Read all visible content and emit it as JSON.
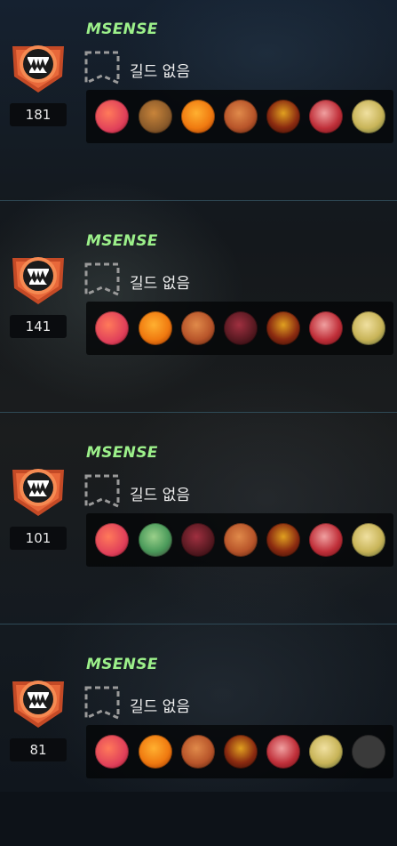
{
  "matches": [
    {
      "name": "MSENSE",
      "level": "181",
      "guild": "길드 없음",
      "champions": [
        {
          "icon": "champion-portrait-pink-fire",
          "color": "#e0405a"
        },
        {
          "icon": "champion-portrait-brown-beast",
          "color": "#8a5a2a"
        },
        {
          "icon": "champion-portrait-orange-flame",
          "color": "#f07a10"
        },
        {
          "icon": "champion-portrait-red-horned",
          "color": "#b8552a"
        },
        {
          "icon": "champion-portrait-dark-red-armor",
          "color": "#8a2a10"
        },
        {
          "icon": "champion-portrait-red-jester",
          "color": "#c0303a"
        },
        {
          "icon": "champion-portrait-yellow-knight",
          "color": "#c8b458"
        }
      ]
    },
    {
      "name": "MSENSE",
      "level": "141",
      "guild": "길드 없음",
      "champions": [
        {
          "icon": "champion-portrait-pink-fire",
          "color": "#e0405a"
        },
        {
          "icon": "champion-portrait-orange-flame",
          "color": "#f07a10"
        },
        {
          "icon": "champion-portrait-red-horned",
          "color": "#b8552a"
        },
        {
          "icon": "champion-portrait-crimson-demon",
          "color": "#5a1a22"
        },
        {
          "icon": "champion-portrait-dark-red-armor",
          "color": "#8a2a10"
        },
        {
          "icon": "champion-portrait-red-jester",
          "color": "#c0303a"
        },
        {
          "icon": "champion-portrait-yellow-knight",
          "color": "#c8b458"
        }
      ]
    },
    {
      "name": "MSENSE",
      "level": "101",
      "guild": "길드 없음",
      "champions": [
        {
          "icon": "champion-portrait-pink-fire",
          "color": "#e0405a"
        },
        {
          "icon": "champion-portrait-green-goblin",
          "color": "#4a9a5a"
        },
        {
          "icon": "champion-portrait-crimson-demon",
          "color": "#5a1a22"
        },
        {
          "icon": "champion-portrait-red-horned",
          "color": "#b8552a"
        },
        {
          "icon": "champion-portrait-dark-red-armor",
          "color": "#8a2a10"
        },
        {
          "icon": "champion-portrait-red-jester",
          "color": "#c0303a"
        },
        {
          "icon": "champion-portrait-yellow-knight",
          "color": "#c8b458"
        }
      ]
    },
    {
      "name": "MSENSE",
      "level": "81",
      "guild": "길드 없음",
      "champions": [
        {
          "icon": "champion-portrait-pink-fire",
          "color": "#e0405a"
        },
        {
          "icon": "champion-portrait-orange-flame",
          "color": "#f07a10"
        },
        {
          "icon": "champion-portrait-red-horned",
          "color": "#b8552a"
        },
        {
          "icon": "champion-portrait-dark-red-armor",
          "color": "#8a2a10"
        },
        {
          "icon": "champion-portrait-red-jester",
          "color": "#c0303a"
        },
        {
          "icon": "champion-portrait-yellow-knight",
          "color": "#c8b458"
        },
        {
          "icon": "empty-champion-slot",
          "color": "#3a3a3a"
        }
      ]
    }
  ],
  "colors": {
    "name": "#9cf08a",
    "divider": "#2f4a56",
    "badge_orange": "#e8683a",
    "badge_dark": "#1b1b1b"
  }
}
